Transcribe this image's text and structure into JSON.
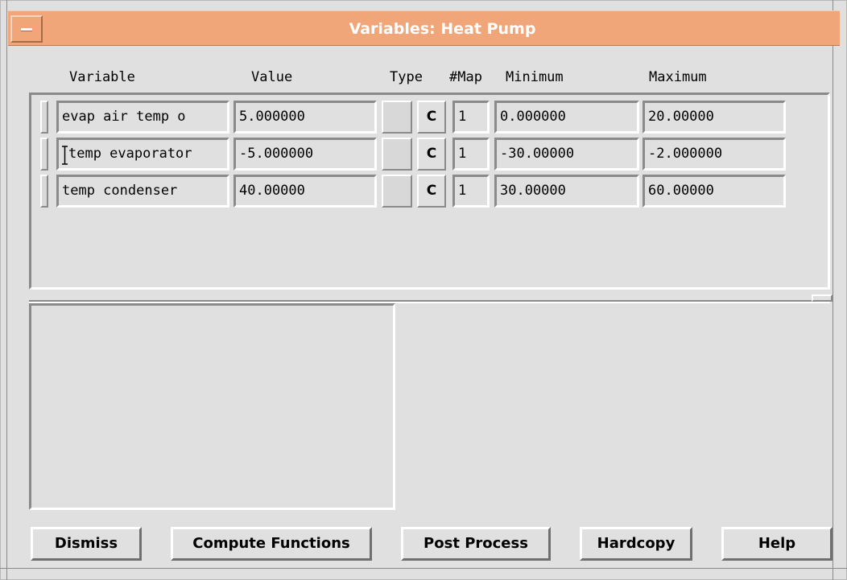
{
  "window": {
    "title": "Variables: Heat Pump"
  },
  "columns": {
    "variable": "Variable",
    "value": "Value",
    "type": "Type",
    "map": "#Map",
    "minimum": "Minimum",
    "maximum": "Maximum"
  },
  "rows": [
    {
      "name": "evap air temp o",
      "value": "5.000000",
      "type_button": "C",
      "map": "1",
      "minimum": "0.000000",
      "maximum": "20.00000"
    },
    {
      "name": "temp evaporator",
      "value": "-5.000000",
      "type_button": "C",
      "map": "1",
      "minimum": "-30.00000",
      "maximum": "-2.000000"
    },
    {
      "name": "temp condenser",
      "value": "40.00000",
      "type_button": "C",
      "map": "1",
      "minimum": "30.00000",
      "maximum": "60.00000"
    }
  ],
  "buttons": {
    "dismiss": "Dismiss",
    "compute_functions": "Compute Functions",
    "post_process": "Post Process",
    "hardcopy": "Hardcopy",
    "help": "Help"
  },
  "colors": {
    "title_bar": "#f0a679",
    "title_text": "#ffffff",
    "background": "#e0e0e0"
  },
  "icons": {
    "window_menu": "window-menu-icon",
    "text_cursor": "text-cursor-icon"
  }
}
